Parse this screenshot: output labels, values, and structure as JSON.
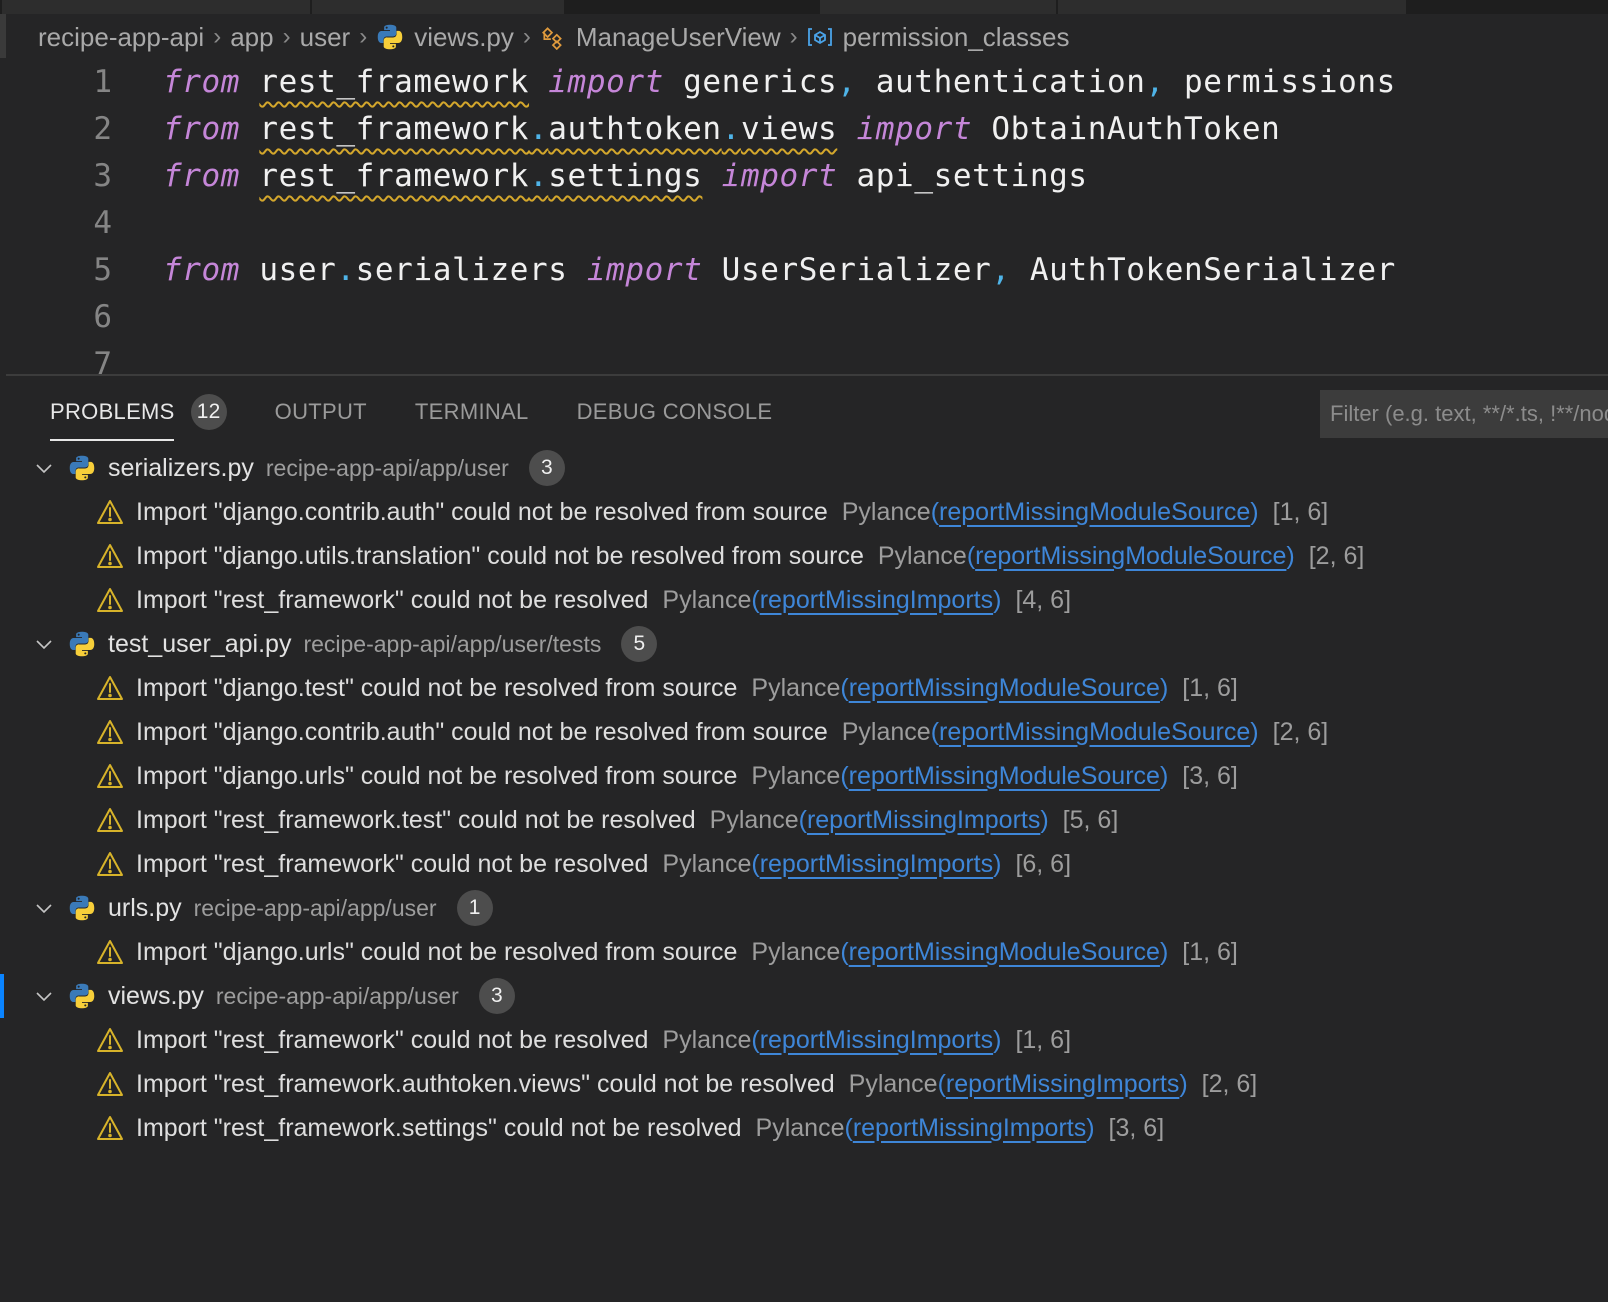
{
  "breadcrumb": [
    {
      "label": "recipe-app-api",
      "icon": null
    },
    {
      "label": "app",
      "icon": null
    },
    {
      "label": "user",
      "icon": null
    },
    {
      "label": "views.py",
      "icon": "python-icon"
    },
    {
      "label": "ManageUserView",
      "icon": "class-icon"
    },
    {
      "label": "permission_classes",
      "icon": "variable-icon"
    }
  ],
  "editor": {
    "lines": [
      {
        "number": "1",
        "tokens": [
          {
            "t": "from",
            "c": "kw"
          },
          {
            "t": " "
          },
          {
            "t": "rest_framework",
            "c": "squig"
          },
          {
            "t": " "
          },
          {
            "t": "import",
            "c": "kw"
          },
          {
            "t": " generics"
          },
          {
            "t": ",",
            "c": "punc"
          },
          {
            "t": " authentication"
          },
          {
            "t": ",",
            "c": "punc"
          },
          {
            "t": " permissions"
          }
        ]
      },
      {
        "number": "2",
        "tokens": [
          {
            "t": "from",
            "c": "kw"
          },
          {
            "t": " "
          },
          {
            "t": "rest_framework",
            "c": "squig"
          },
          {
            "t": ".",
            "c": "punc squig"
          },
          {
            "t": "authtoken",
            "c": "squig"
          },
          {
            "t": ".",
            "c": "punc squig"
          },
          {
            "t": "views",
            "c": "squig"
          },
          {
            "t": " "
          },
          {
            "t": "import",
            "c": "kw"
          },
          {
            "t": " ObtainAuthToken"
          }
        ]
      },
      {
        "number": "3",
        "tokens": [
          {
            "t": "from",
            "c": "kw"
          },
          {
            "t": " "
          },
          {
            "t": "rest_framework",
            "c": "squig"
          },
          {
            "t": ".",
            "c": "punc squig"
          },
          {
            "t": "settings",
            "c": "squig"
          },
          {
            "t": " "
          },
          {
            "t": "import",
            "c": "kw"
          },
          {
            "t": " api_settings"
          }
        ]
      },
      {
        "number": "4",
        "tokens": []
      },
      {
        "number": "5",
        "tokens": [
          {
            "t": "from",
            "c": "kw"
          },
          {
            "t": " user"
          },
          {
            "t": ".",
            "c": "punc"
          },
          {
            "t": "serializers "
          },
          {
            "t": "import",
            "c": "kw"
          },
          {
            "t": " UserSerializer"
          },
          {
            "t": ",",
            "c": "punc"
          },
          {
            "t": " AuthTokenSerializer"
          }
        ]
      },
      {
        "number": "6",
        "tokens": []
      },
      {
        "number": "7",
        "tokens": []
      }
    ]
  },
  "panel": {
    "tabs": [
      {
        "label": "PROBLEMS",
        "badge": "12",
        "active": true
      },
      {
        "label": "OUTPUT"
      },
      {
        "label": "TERMINAL"
      },
      {
        "label": "DEBUG CONSOLE"
      }
    ],
    "filter_placeholder": "Filter (e.g. text, **/*.ts, !**/node_modules/**)"
  },
  "problems": [
    {
      "file": "serializers.py",
      "path": "recipe-app-api/app/user",
      "count": "3",
      "selected": false,
      "items": [
        {
          "message": "Import \"django.contrib.auth\" could not be resolved from source",
          "source": "Pylance",
          "code": "reportMissingModuleSource",
          "location": "[1, 6]"
        },
        {
          "message": "Import \"django.utils.translation\" could not be resolved from source",
          "source": "Pylance",
          "code": "reportMissingModuleSource",
          "location": "[2, 6]"
        },
        {
          "message": "Import \"rest_framework\" could not be resolved",
          "source": "Pylance",
          "code": "reportMissingImports",
          "location": "[4, 6]"
        }
      ]
    },
    {
      "file": "test_user_api.py",
      "path": "recipe-app-api/app/user/tests",
      "count": "5",
      "selected": false,
      "items": [
        {
          "message": "Import \"django.test\" could not be resolved from source",
          "source": "Pylance",
          "code": "reportMissingModuleSource",
          "location": "[1, 6]"
        },
        {
          "message": "Import \"django.contrib.auth\" could not be resolved from source",
          "source": "Pylance",
          "code": "reportMissingModuleSource",
          "location": "[2, 6]"
        },
        {
          "message": "Import \"django.urls\" could not be resolved from source",
          "source": "Pylance",
          "code": "reportMissingModuleSource",
          "location": "[3, 6]"
        },
        {
          "message": "Import \"rest_framework.test\" could not be resolved",
          "source": "Pylance",
          "code": "reportMissingImports",
          "location": "[5, 6]"
        },
        {
          "message": "Import \"rest_framework\" could not be resolved",
          "source": "Pylance",
          "code": "reportMissingImports",
          "location": "[6, 6]"
        }
      ]
    },
    {
      "file": "urls.py",
      "path": "recipe-app-api/app/user",
      "count": "1",
      "selected": false,
      "items": [
        {
          "message": "Import \"django.urls\" could not be resolved from source",
          "source": "Pylance",
          "code": "reportMissingModuleSource",
          "location": "[1, 6]"
        }
      ]
    },
    {
      "file": "views.py",
      "path": "recipe-app-api/app/user",
      "count": "3",
      "selected": true,
      "items": [
        {
          "message": "Import \"rest_framework\" could not be resolved",
          "source": "Pylance",
          "code": "reportMissingImports",
          "location": "[1, 6]"
        },
        {
          "message": "Import \"rest_framework.authtoken.views\" could not be resolved",
          "source": "Pylance",
          "code": "reportMissingImports",
          "location": "[2, 6]"
        },
        {
          "message": "Import \"rest_framework.settings\" could not be resolved",
          "source": "Pylance",
          "code": "reportMissingImports",
          "location": "[3, 6]"
        }
      ]
    }
  ]
}
